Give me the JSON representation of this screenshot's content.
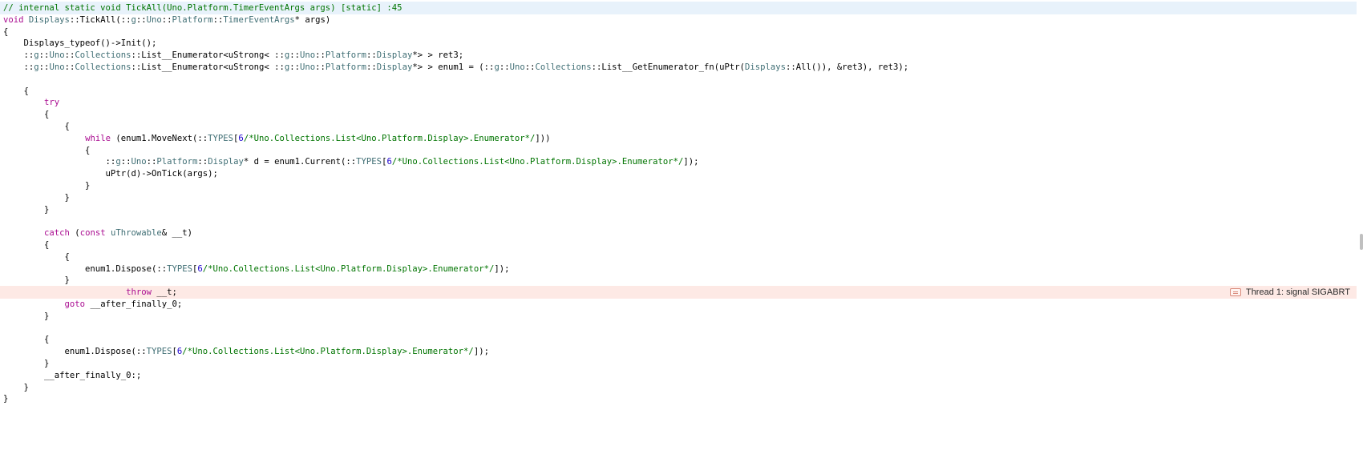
{
  "editor": {
    "lines": [
      {
        "state": "current",
        "tokens": [
          {
            "t": "// internal static void TickAll(Uno.Platform.TimerEventArgs args) [static] :45",
            "c": "cmt"
          }
        ]
      },
      {
        "tokens": [
          {
            "t": "void ",
            "c": "kw"
          },
          {
            "t": "Displays",
            "c": "type"
          },
          {
            "t": "::TickAll(::",
            "c": "plain"
          },
          {
            "t": "g",
            "c": "type"
          },
          {
            "t": "::",
            "c": "plain"
          },
          {
            "t": "Uno",
            "c": "type"
          },
          {
            "t": "::",
            "c": "plain"
          },
          {
            "t": "Platform",
            "c": "type"
          },
          {
            "t": "::",
            "c": "plain"
          },
          {
            "t": "TimerEventArgs",
            "c": "type"
          },
          {
            "t": "* args)",
            "c": "plain"
          }
        ]
      },
      {
        "tokens": [
          {
            "t": "{",
            "c": "plain"
          }
        ]
      },
      {
        "tokens": [
          {
            "t": "    Displays_typeof()->Init();",
            "c": "plain"
          }
        ]
      },
      {
        "tokens": [
          {
            "t": "    ::",
            "c": "plain"
          },
          {
            "t": "g",
            "c": "type"
          },
          {
            "t": "::",
            "c": "plain"
          },
          {
            "t": "Uno",
            "c": "type"
          },
          {
            "t": "::",
            "c": "plain"
          },
          {
            "t": "Collections",
            "c": "type"
          },
          {
            "t": "::List__Enumerator<uStrong< ::",
            "c": "plain"
          },
          {
            "t": "g",
            "c": "type"
          },
          {
            "t": "::",
            "c": "plain"
          },
          {
            "t": "Uno",
            "c": "type"
          },
          {
            "t": "::",
            "c": "plain"
          },
          {
            "t": "Platform",
            "c": "type"
          },
          {
            "t": "::",
            "c": "plain"
          },
          {
            "t": "Display",
            "c": "type"
          },
          {
            "t": "*> > ret3;",
            "c": "plain"
          }
        ]
      },
      {
        "tokens": [
          {
            "t": "    ::",
            "c": "plain"
          },
          {
            "t": "g",
            "c": "type"
          },
          {
            "t": "::",
            "c": "plain"
          },
          {
            "t": "Uno",
            "c": "type"
          },
          {
            "t": "::",
            "c": "plain"
          },
          {
            "t": "Collections",
            "c": "type"
          },
          {
            "t": "::List__Enumerator<uStrong< ::",
            "c": "plain"
          },
          {
            "t": "g",
            "c": "type"
          },
          {
            "t": "::",
            "c": "plain"
          },
          {
            "t": "Uno",
            "c": "type"
          },
          {
            "t": "::",
            "c": "plain"
          },
          {
            "t": "Platform",
            "c": "type"
          },
          {
            "t": "::",
            "c": "plain"
          },
          {
            "t": "Display",
            "c": "type"
          },
          {
            "t": "*> > enum1 = (::",
            "c": "plain"
          },
          {
            "t": "g",
            "c": "type"
          },
          {
            "t": "::",
            "c": "plain"
          },
          {
            "t": "Uno",
            "c": "type"
          },
          {
            "t": "::",
            "c": "plain"
          },
          {
            "t": "Collections",
            "c": "type"
          },
          {
            "t": "::List__GetEnumerator_fn(uPtr(",
            "c": "plain"
          },
          {
            "t": "Displays",
            "c": "type"
          },
          {
            "t": "::All()), &ret3), ret3);",
            "c": "plain"
          }
        ]
      },
      {
        "tokens": []
      },
      {
        "tokens": [
          {
            "t": "    {",
            "c": "plain"
          }
        ]
      },
      {
        "tokens": [
          {
            "t": "        ",
            "c": "plain"
          },
          {
            "t": "try",
            "c": "kw"
          }
        ]
      },
      {
        "tokens": [
          {
            "t": "        {",
            "c": "plain"
          }
        ]
      },
      {
        "tokens": [
          {
            "t": "            {",
            "c": "plain"
          }
        ]
      },
      {
        "tokens": [
          {
            "t": "                ",
            "c": "plain"
          },
          {
            "t": "while",
            "c": "kw"
          },
          {
            "t": " (enum1.MoveNext(::",
            "c": "plain"
          },
          {
            "t": "TYPES",
            "c": "type"
          },
          {
            "t": "[",
            "c": "plain"
          },
          {
            "t": "6",
            "c": "num"
          },
          {
            "t": "/*Uno.Collections.List<Uno.Platform.Display>.Enumerator*/",
            "c": "cmt"
          },
          {
            "t": "]))",
            "c": "plain"
          }
        ]
      },
      {
        "tokens": [
          {
            "t": "                {",
            "c": "plain"
          }
        ]
      },
      {
        "tokens": [
          {
            "t": "                    ::",
            "c": "plain"
          },
          {
            "t": "g",
            "c": "type"
          },
          {
            "t": "::",
            "c": "plain"
          },
          {
            "t": "Uno",
            "c": "type"
          },
          {
            "t": "::",
            "c": "plain"
          },
          {
            "t": "Platform",
            "c": "type"
          },
          {
            "t": "::",
            "c": "plain"
          },
          {
            "t": "Display",
            "c": "type"
          },
          {
            "t": "* d = enum1.Current(::",
            "c": "plain"
          },
          {
            "t": "TYPES",
            "c": "type"
          },
          {
            "t": "[",
            "c": "plain"
          },
          {
            "t": "6",
            "c": "num"
          },
          {
            "t": "/*Uno.Collections.List<Uno.Platform.Display>.Enumerator*/",
            "c": "cmt"
          },
          {
            "t": "]);",
            "c": "plain"
          }
        ]
      },
      {
        "tokens": [
          {
            "t": "                    uPtr(d)->OnTick(args);",
            "c": "plain"
          }
        ]
      },
      {
        "tokens": [
          {
            "t": "                }",
            "c": "plain"
          }
        ]
      },
      {
        "tokens": [
          {
            "t": "            }",
            "c": "plain"
          }
        ]
      },
      {
        "tokens": [
          {
            "t": "        }",
            "c": "plain"
          }
        ]
      },
      {
        "tokens": []
      },
      {
        "tokens": [
          {
            "t": "        ",
            "c": "plain"
          },
          {
            "t": "catch",
            "c": "kw"
          },
          {
            "t": " (",
            "c": "plain"
          },
          {
            "t": "const",
            "c": "kw"
          },
          {
            "t": " ",
            "c": "plain"
          },
          {
            "t": "uThrowable",
            "c": "type"
          },
          {
            "t": "& __t)",
            "c": "plain"
          }
        ]
      },
      {
        "tokens": [
          {
            "t": "        {",
            "c": "plain"
          }
        ]
      },
      {
        "tokens": [
          {
            "t": "            {",
            "c": "plain"
          }
        ]
      },
      {
        "tokens": [
          {
            "t": "                enum1.Dispose(::",
            "c": "plain"
          },
          {
            "t": "TYPES",
            "c": "type"
          },
          {
            "t": "[",
            "c": "plain"
          },
          {
            "t": "6",
            "c": "num"
          },
          {
            "t": "/*Uno.Collections.List<Uno.Platform.Display>.Enumerator*/",
            "c": "cmt"
          },
          {
            "t": "]);",
            "c": "plain"
          }
        ]
      },
      {
        "tokens": [
          {
            "t": "            }",
            "c": "plain"
          }
        ]
      },
      {
        "state": "error",
        "tokens": [
          {
            "t": "                        ",
            "c": "plain"
          },
          {
            "t": "throw",
            "c": "kw"
          },
          {
            "t": " __t;",
            "c": "plain"
          }
        ]
      },
      {
        "tokens": [
          {
            "t": "            ",
            "c": "plain"
          },
          {
            "t": "goto",
            "c": "kw"
          },
          {
            "t": " __after_finally_0;",
            "c": "plain"
          }
        ]
      },
      {
        "tokens": [
          {
            "t": "        }",
            "c": "plain"
          }
        ]
      },
      {
        "tokens": []
      },
      {
        "tokens": [
          {
            "t": "        {",
            "c": "plain"
          }
        ]
      },
      {
        "tokens": [
          {
            "t": "            enum1.Dispose(::",
            "c": "plain"
          },
          {
            "t": "TYPES",
            "c": "type"
          },
          {
            "t": "[",
            "c": "plain"
          },
          {
            "t": "6",
            "c": "num"
          },
          {
            "t": "/*Uno.Collections.List<Uno.Platform.Display>.Enumerator*/",
            "c": "cmt"
          },
          {
            "t": "]);",
            "c": "plain"
          }
        ]
      },
      {
        "tokens": [
          {
            "t": "        }",
            "c": "plain"
          }
        ]
      },
      {
        "tokens": [
          {
            "t": "        __after_finally_0:;",
            "c": "plain"
          }
        ]
      },
      {
        "tokens": [
          {
            "t": "    }",
            "c": "plain"
          }
        ]
      },
      {
        "tokens": [
          {
            "t": "}",
            "c": "plain"
          }
        ]
      }
    ],
    "error_badge": {
      "icon": "error-lines-icon",
      "text": "Thread 1: signal SIGABRT"
    }
  },
  "colors": {
    "current_line_bg": "#e8f2fb",
    "error_line_bg": "#fde9e5",
    "keyword": "#aa0d91",
    "type": "#3f6e74",
    "comment": "#007400",
    "number": "#1c00cf",
    "plain": "#000000"
  }
}
